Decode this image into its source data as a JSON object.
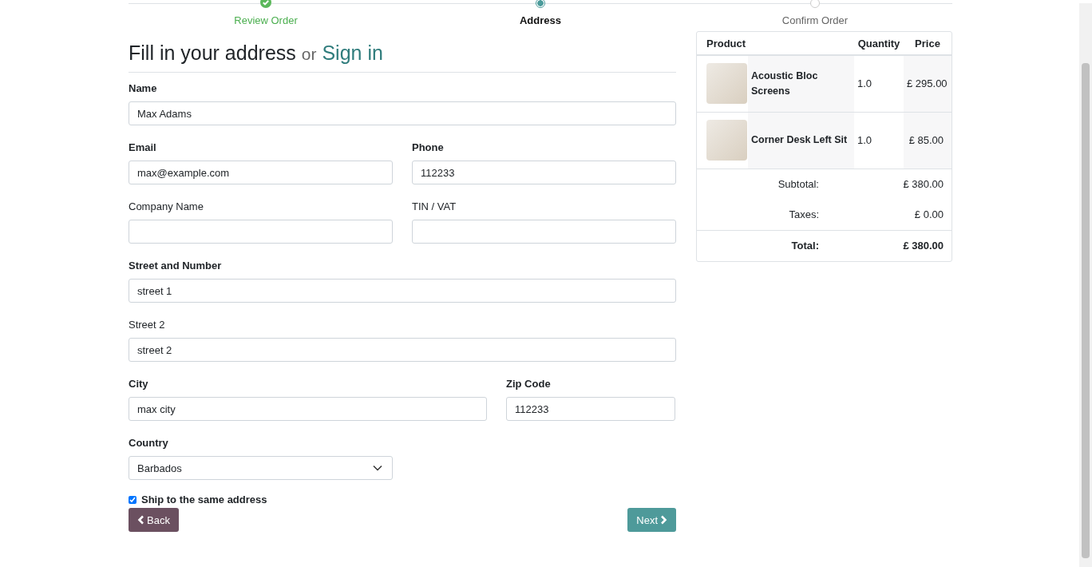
{
  "steps": [
    {
      "label": "Review Order",
      "completed": true,
      "selected": false
    },
    {
      "label": "Address",
      "completed": false,
      "selected": true
    },
    {
      "label": "Confirm Order",
      "completed": false,
      "selected": false
    }
  ],
  "heading": {
    "title": "Fill in your address",
    "or": "or",
    "link": "Sign in"
  },
  "form": {
    "rows": [
      {
        "fields": [
          {
            "label": "Name",
            "required": true,
            "kind": "text",
            "value": "Max Adams"
          }
        ]
      },
      {
        "fields": [
          {
            "label": "Email",
            "required": true,
            "kind": "text",
            "value": "max@example.com"
          },
          {
            "label": "Phone",
            "required": true,
            "kind": "text",
            "value": "112233"
          }
        ]
      },
      {
        "fields": [
          {
            "label": "Company Name",
            "required": false,
            "kind": "text"
          },
          {
            "label": "TIN / VAT",
            "required": false,
            "kind": "text"
          }
        ]
      },
      {
        "fields": [
          {
            "label": "Street and Number",
            "required": true,
            "kind": "text",
            "value": "street 1"
          }
        ]
      },
      {
        "fields": [
          {
            "label": "Street 2",
            "required": false,
            "kind": "text",
            "value": "street 2"
          }
        ]
      },
      {
        "fields": [
          {
            "label": "City",
            "required": true,
            "kind": "text",
            "value": "max city"
          },
          {
            "label": "Zip Code",
            "required": true,
            "kind": "text",
            "value": "112233"
          }
        ]
      },
      {
        "fields": [
          {
            "label": "Country",
            "required": true,
            "kind": "select",
            "value": "Barbados"
          }
        ]
      }
    ],
    "ship_same": {
      "label": "Ship to the same address",
      "checked": true
    },
    "buttons": {
      "back": "Back",
      "next": "Next"
    }
  },
  "cart": {
    "columns": [
      "Product",
      "Quantity",
      "Price"
    ],
    "rows": [
      {
        "name": "Acoustic Bloc Screens",
        "quantity": "1.0",
        "price": "£ 295.00"
      },
      {
        "name": "Corner Desk Left Sit",
        "quantity": "1.0",
        "price": "£ 85.00"
      }
    ],
    "totals": [
      {
        "label": "Subtotal:",
        "value": "£ 380.00",
        "bold": false
      },
      {
        "label": "Taxes:",
        "value": "£ 0.00",
        "bold": false
      },
      {
        "label": "Total:",
        "value": "£ 380.00",
        "bold": true
      }
    ]
  }
}
